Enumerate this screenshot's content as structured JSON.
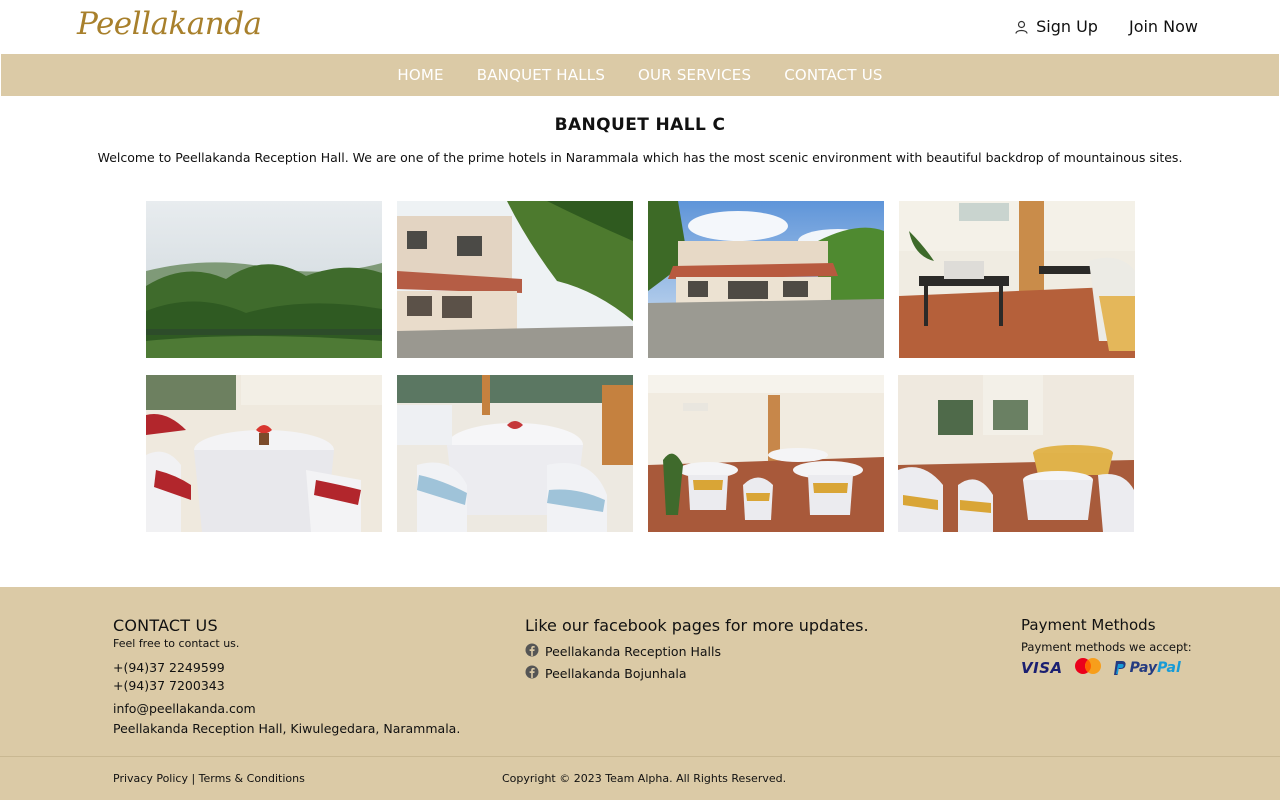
{
  "header": {
    "logo": "Peellakanda",
    "sign_up": "Sign Up",
    "join_now": "Join Now"
  },
  "nav": {
    "items": [
      "HOME",
      "BANQUET HALLS",
      "OUR SERVICES",
      "CONTACT US"
    ]
  },
  "main": {
    "title": "BANQUET HALL C",
    "intro": "Welcome to Peellakanda Reception Hall. We are one of the prime hotels in Narammala which has the most scenic environment with beautiful backdrop of mountainous sites.",
    "photos": [
      {
        "subject": "mountain-view"
      },
      {
        "subject": "building-exterior-left"
      },
      {
        "subject": "building-exterior-front"
      },
      {
        "subject": "buffet-hall"
      },
      {
        "subject": "tables-red-sashes"
      },
      {
        "subject": "tables-blue-sashes"
      },
      {
        "subject": "hall-wide-gold-sashes"
      },
      {
        "subject": "hall-gold-sashes"
      }
    ]
  },
  "footer": {
    "contact_heading": "CONTACT US",
    "contact_sub": "Feel free to contact us.",
    "phone1": "+(94)37 2249599",
    "phone2": "+(94)37 7200343",
    "email": "info@peellakanda.com",
    "address": "Peellakanda Reception Hall, Kiwulegedara, Narammala.",
    "fb_heading": "Like our facebook pages for more updates.",
    "fb_links": [
      "Peellakanda Reception Halls",
      "Peellakanda Bojunhala"
    ],
    "pay_heading": "Payment Methods",
    "pay_sub": "Payment methods we accept:",
    "visa": "VISA",
    "mastercard": "MasterCard",
    "paypal_1": "Pay",
    "paypal_2": "Pal",
    "privacy": "Privacy Policy",
    "separator": " | ",
    "terms": "Terms & Conditions",
    "copyright": "Copyright © 2023 Team Alpha. All Rights Reserved."
  },
  "colors": {
    "accent": "#dbcaa6",
    "logo": "#a8802c"
  }
}
